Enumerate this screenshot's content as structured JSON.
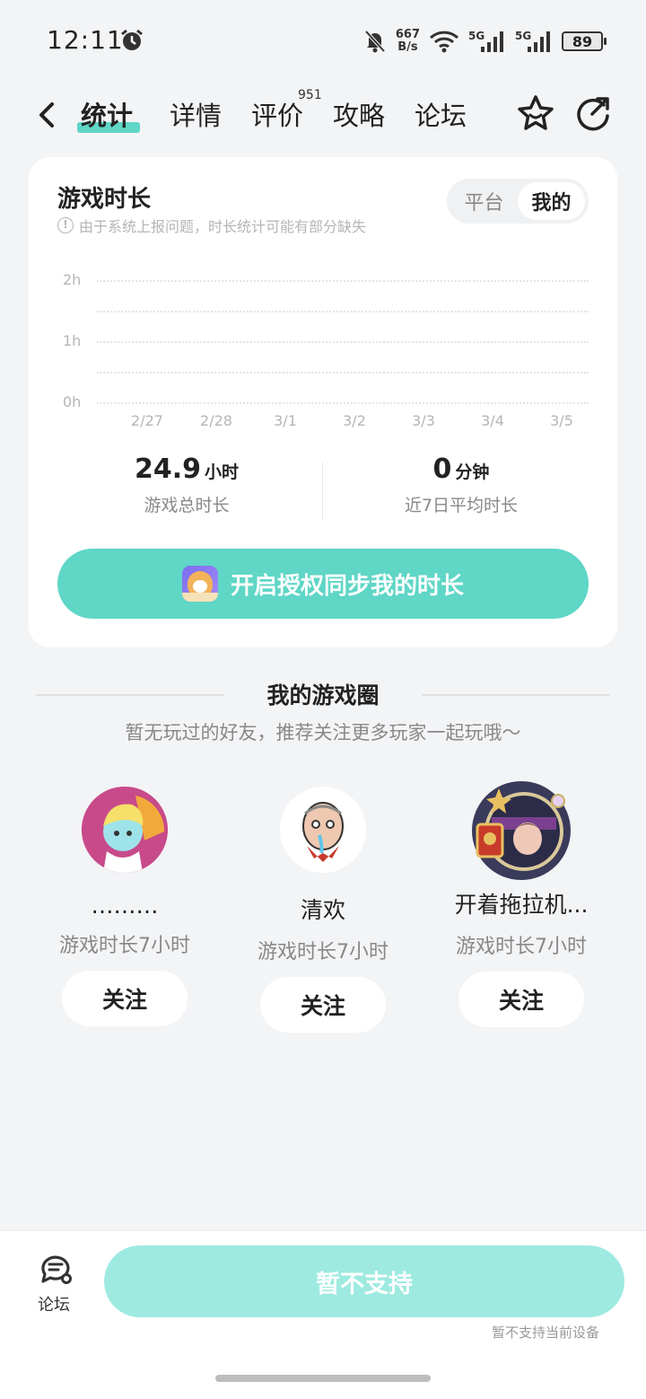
{
  "status_bar": {
    "time": "12:11",
    "net_speed_value": "667",
    "net_speed_unit": "B/s",
    "battery": "89",
    "sim1": "5G",
    "sim2": "5G"
  },
  "nav": {
    "tabs": [
      {
        "label": "统计",
        "active": true
      },
      {
        "label": "详情"
      },
      {
        "label": "评价",
        "badge": "951"
      },
      {
        "label": "攻略"
      },
      {
        "label": "论坛"
      }
    ]
  },
  "card": {
    "title": "游戏时长",
    "note": "由于系统上报问题，时长统计可能有部分缺失",
    "toggle": [
      "平台",
      "我的"
    ],
    "toggle_selected": "我的"
  },
  "chart_data": {
    "type": "bar",
    "categories": [
      "2/27",
      "2/28",
      "3/1",
      "3/2",
      "3/3",
      "3/4",
      "3/5"
    ],
    "values": [
      0,
      0,
      0,
      0,
      0,
      0,
      0
    ],
    "y_ticks": [
      "2h",
      "1h",
      "0h"
    ],
    "ylim": [
      0,
      2
    ],
    "grid": true
  },
  "stats": {
    "total": {
      "value": "24.9",
      "unit": "小时",
      "label": "游戏总时长"
    },
    "avg": {
      "value": "0",
      "unit": "分钟",
      "label": "近7日平均时长"
    }
  },
  "sync_button": "开启授权同步我的时长",
  "circle": {
    "title": "我的游戏圈",
    "subtitle": "暂无玩过的好友，推荐关注更多玩家一起玩哦～",
    "friends": [
      {
        "name": "………",
        "meta": "游戏时长7小时",
        "action": "关注"
      },
      {
        "name": "清欢",
        "meta": "游戏时长7小时",
        "action": "关注"
      },
      {
        "name": "开着拖拉机...",
        "meta": "游戏时长7小时",
        "action": "关注"
      }
    ]
  },
  "bottom": {
    "forum_label": "论坛",
    "main_button": "暂不支持",
    "note": "暂不支持当前设备"
  }
}
